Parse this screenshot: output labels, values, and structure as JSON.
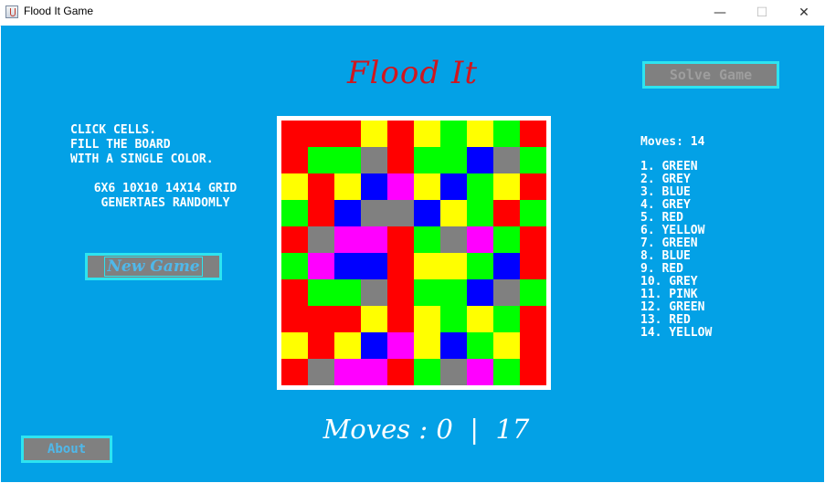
{
  "window": {
    "title": "Flood It Game"
  },
  "heading": "Flood It",
  "instructions": {
    "line1": "CLICK CELLS.",
    "line2": "FILL THE BOARD",
    "line3": "WITH A SINGLE COLOR.",
    "line4": "6X6 10X10 14X14 GRID",
    "line5": "GENERTAES RANDOMLY"
  },
  "buttons": {
    "new_game": "New Game",
    "solve_game": "Solve Game",
    "about": "About"
  },
  "colors": {
    "R": "#ff0000",
    "G": "#00ff00",
    "B": "#0000ff",
    "Y": "#ffff00",
    "P": "#ff00ff",
    "E": "#808080",
    "background": "#03a1e6",
    "title_red": "#d0161e",
    "button_border": "#2de4f0"
  },
  "board": {
    "rows": [
      [
        "R",
        "R",
        "R",
        "Y",
        "R",
        "Y",
        "G",
        "Y",
        "G",
        "R"
      ],
      [
        "R",
        "G",
        "G",
        "E",
        "R",
        "G",
        "G",
        "B",
        "E",
        "G"
      ],
      [
        "Y",
        "R",
        "Y",
        "B",
        "P",
        "Y",
        "B",
        "G",
        "Y",
        "R"
      ],
      [
        "G",
        "R",
        "B",
        "E",
        "E",
        "B",
        "Y",
        "G",
        "R",
        "G"
      ],
      [
        "R",
        "E",
        "P",
        "P",
        "R",
        "G",
        "E",
        "P",
        "G",
        "R"
      ],
      [
        "G",
        "P",
        "B",
        "B",
        "R",
        "Y",
        "Y",
        "G",
        "B",
        "R"
      ],
      [
        "R",
        "G",
        "G",
        "E",
        "R",
        "G",
        "G",
        "B",
        "E",
        "G"
      ],
      [
        "R",
        "R",
        "R",
        "Y",
        "R",
        "Y",
        "G",
        "Y",
        "G",
        "R"
      ],
      [
        "Y",
        "R",
        "Y",
        "B",
        "P",
        "Y",
        "B",
        "G",
        "Y",
        "R"
      ],
      [
        "R",
        "E",
        "P",
        "P",
        "R",
        "G",
        "E",
        "P",
        "G",
        "R"
      ]
    ]
  },
  "moves_label": "Moves : 0  |  17",
  "moves_panel": {
    "count_label": "Moves: 14",
    "items": [
      "1. GREEN",
      "2. GREY",
      "3. BLUE",
      "4. GREY",
      "5. RED",
      "6. YELLOW",
      "7. GREEN",
      "8. BLUE",
      "9. RED",
      "10. GREY",
      "11. PINK",
      "12. GREEN",
      "13. RED",
      "14. YELLOW"
    ]
  }
}
